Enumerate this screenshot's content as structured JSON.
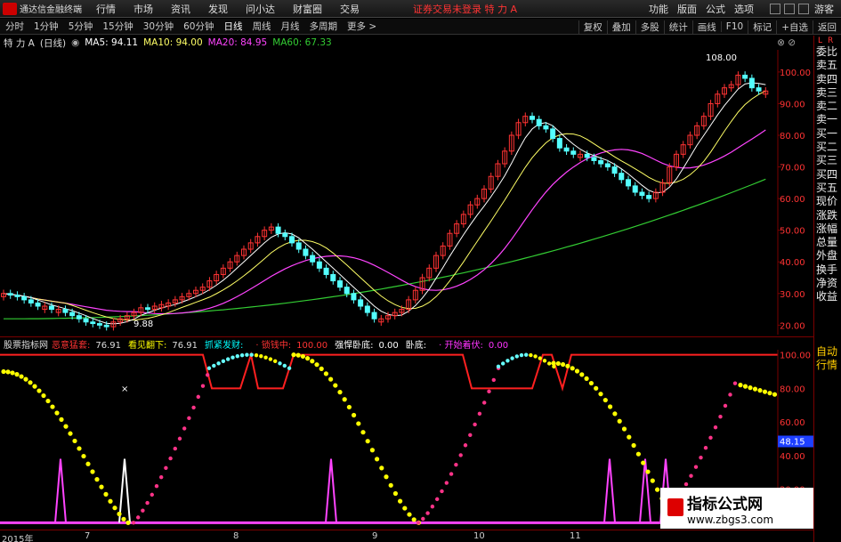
{
  "menu": {
    "app_name": "通达信金融终端",
    "items": [
      "行情",
      "市场",
      "资讯",
      "发现",
      "问小达",
      "财富圈",
      "交易"
    ],
    "status": "证券交易未登录  特 力 A",
    "right_items": [
      "功能",
      "版面",
      "公式",
      "选项"
    ],
    "user": "游客"
  },
  "periods": {
    "items": [
      "分时",
      "1分钟",
      "5分钟",
      "15分钟",
      "30分钟",
      "60分钟",
      "日线",
      "周线",
      "月线",
      "多周期",
      "更多 >"
    ],
    "active": "日线",
    "right_items": [
      "复权",
      "叠加",
      "多股",
      "统计",
      "画线",
      "F10",
      "标记",
      "+自选",
      "返回"
    ]
  },
  "main_header": {
    "stock": "特 力 A",
    "period": "(日线)",
    "ma5": "MA5: 94.11",
    "ma10": "MA10: 94.00",
    "ma20": "MA20: 84.95",
    "ma60": "MA60: 67.33"
  },
  "sub_header": {
    "name": "股票指标网",
    "items": [
      {
        "label": "恶意猛套:",
        "value": "76.91",
        "color": "#ff3333"
      },
      {
        "label": "看见翻下:",
        "value": "76.91",
        "color": "#ffff00"
      },
      {
        "label": "抓紧发财:",
        "value": "",
        "color": "#00ffff"
      },
      {
        "label": "· 锁钱中:",
        "value": "100.00",
        "color": "#ff3333"
      },
      {
        "label": "强悍卧底:",
        "value": "0.00",
        "color": "#ffffff"
      },
      {
        "label": "卧底:",
        "value": "",
        "color": "#ffffff"
      },
      {
        "label": "· 开始着伏:",
        "value": "0.00",
        "color": "#ff33ff"
      }
    ]
  },
  "price_axis": {
    "ticks": [
      "100.00",
      "90.00",
      "80.00",
      "70.00",
      "60.00",
      "50.00",
      "40.00",
      "30.00",
      "20.00"
    ],
    "ylim": [
      17,
      107
    ],
    "high_label": "108.00",
    "low_label": "9.88"
  },
  "sub_axis": {
    "ticks": [
      "100.00",
      "80.00",
      "60.00",
      "40.00",
      "20.00"
    ],
    "ylim": [
      -3,
      103
    ],
    "current": "48.15"
  },
  "right_panel": {
    "top_letters": [
      "L",
      "R"
    ],
    "items": [
      "委比",
      "卖五",
      "卖四",
      "卖三",
      "卖二",
      "卖一",
      "买一",
      "买二",
      "买三",
      "买四",
      "买五",
      "现价",
      "涨跌",
      "涨幅",
      "总量",
      "外盘",
      "换手",
      "净资",
      "收益",
      "",
      "自动",
      "行情"
    ]
  },
  "dates": [
    "2015年",
    "7",
    "8",
    "9",
    "10",
    "11"
  ],
  "watermark": {
    "title": "指标公式网",
    "url": "www.zbgs3.com"
  },
  "colors": {
    "up": "#ff3333",
    "down": "#54ffff",
    "ma5": "#ffffff",
    "ma10": "#ffff66",
    "ma20": "#ff44ff",
    "ma60": "#33cc33",
    "yellow_dots": "#ffff00",
    "pink_dots": "#ff3388",
    "cyan_x": "#66ffff",
    "red_line": "#ff2020",
    "magenta_spike": "#ff44ff"
  },
  "chart_data": {
    "type": "candlestick",
    "prices_approx": [
      30,
      29.5,
      29,
      28,
      27,
      26,
      26,
      25,
      25,
      24,
      23,
      22,
      21,
      20.5,
      20,
      19.5,
      21,
      22,
      23,
      24,
      25.5,
      25,
      26,
      26.5,
      27,
      28,
      29,
      30,
      31,
      32,
      34,
      36,
      38,
      40,
      42,
      44,
      46,
      48,
      50,
      51,
      49,
      48,
      46,
      44,
      42,
      40,
      38,
      36,
      34,
      32,
      30,
      28,
      26,
      24,
      22,
      22,
      23,
      24,
      25,
      28,
      31,
      35,
      38,
      42,
      45,
      49,
      52,
      55,
      58,
      60,
      63,
      67,
      71,
      75,
      80,
      84,
      86,
      85,
      83,
      82,
      79,
      76,
      75,
      74,
      74,
      73,
      72,
      71,
      70,
      68,
      66,
      64,
      62,
      61,
      60,
      62,
      65,
      70,
      74,
      77,
      80,
      83,
      86,
      90,
      93,
      95,
      96,
      99,
      98,
      95,
      94,
      94
    ]
  }
}
